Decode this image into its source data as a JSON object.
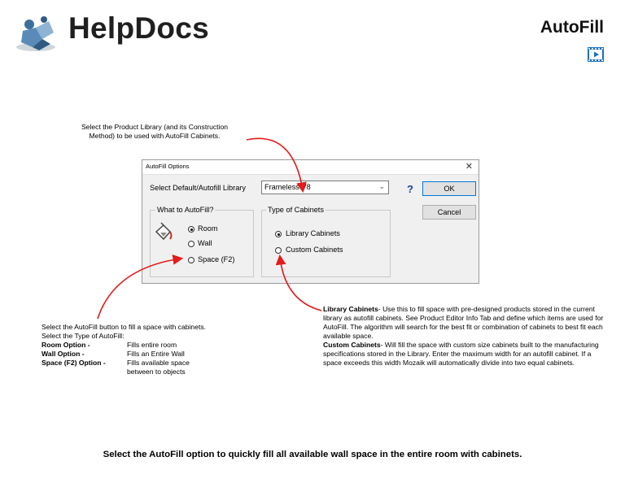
{
  "header": {
    "brand": "HelpDocs",
    "doc_title": "AutoFill",
    "video_icon": "video-play-icon"
  },
  "notes": {
    "top_line1": "Select the Product Library (and its Construction",
    "top_line2": "Method) to be used with AutoFill Cabinets.",
    "left_intro1": "Select the AutoFill button to fill a space with cabinets.",
    "left_intro2": "Select the Type of AutoFill:",
    "options": [
      {
        "key": "Room Option -",
        "val": "Fills entire room"
      },
      {
        "key": "Wall Option -",
        "val": "Fills an Entire Wall"
      },
      {
        "key": "Space (F2) Option -",
        "val": "Fills available space"
      },
      {
        "key": "",
        "val": "between to objects"
      }
    ],
    "right_lib_title": "Library Cabinets",
    "right_lib_text": "- Use this to fill space with pre-designed products stored in the current library as autofill cabinets.  See Product Editor Info Tab and define which items are used for AutoFill.  The algorithm will search for the best fit or combination of cabinets to best fit each available space.",
    "right_custom_title": "Custom Cabinets",
    "right_custom_text": "- Will fill the space with custom size cabinets built to the manufacturing specifications stored in the Library. Enter the maximum width for an autofill cabinet.  If a space exceeds this width Mozaik will automatically divide into two equal cabinets.",
    "bottom": "Select the AutoFill option to quickly fill all available wall space in the entire room with cabinets."
  },
  "dialog": {
    "title": "AutoFill Options",
    "close": "✕",
    "library_label": "Select Default/Autofill Library",
    "library_value": "Frameless V8",
    "ok": "OK",
    "cancel": "Cancel",
    "help": "?",
    "group_what": "What to AutoFill?",
    "what_options": [
      "Room",
      "Wall",
      "Space (F2)"
    ],
    "what_selected": "Room",
    "group_type": "Type of Cabinets",
    "type_options": [
      "Library Cabinets",
      "Custom Cabinets"
    ],
    "type_selected": "Library Cabinets"
  },
  "colors": {
    "arrow": "#e31b1b",
    "ok_border": "#0078d7",
    "brand": "#1f1f1f",
    "video_icon": "#1e6fb8"
  }
}
